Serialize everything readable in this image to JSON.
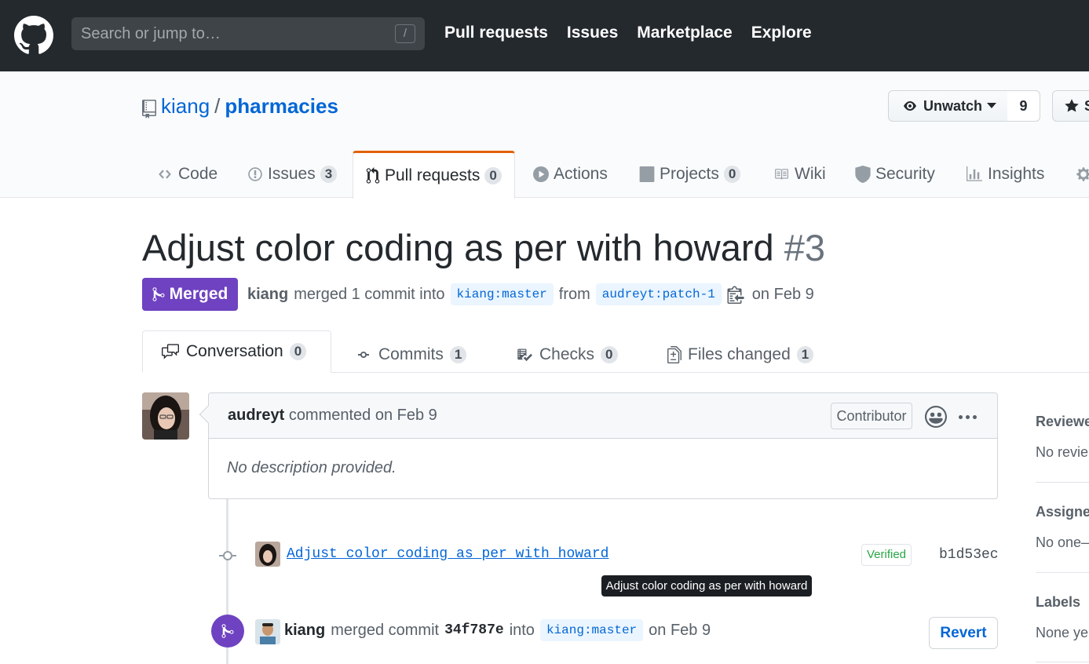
{
  "header": {
    "search_placeholder": "Search or jump to…",
    "search_shortcut": "/",
    "nav": [
      "Pull requests",
      "Issues",
      "Marketplace",
      "Explore"
    ]
  },
  "repo": {
    "owner": "kiang",
    "separator": "/",
    "name": "pharmacies",
    "watch_label": "Unwatch",
    "watch_count": "9",
    "star_label": "S",
    "tabs": [
      {
        "label": "Code",
        "count": null,
        "icon": "code-icon"
      },
      {
        "label": "Issues",
        "count": "3",
        "icon": "issue-icon"
      },
      {
        "label": "Pull requests",
        "count": "0",
        "icon": "pull-request-icon"
      },
      {
        "label": "Actions",
        "count": null,
        "icon": "play-icon"
      },
      {
        "label": "Projects",
        "count": "0",
        "icon": "project-icon"
      },
      {
        "label": "Wiki",
        "count": null,
        "icon": "book-icon"
      },
      {
        "label": "Security",
        "count": null,
        "icon": "shield-icon"
      },
      {
        "label": "Insights",
        "count": null,
        "icon": "graph-icon"
      }
    ]
  },
  "pr": {
    "title": "Adjust color coding as per with howard",
    "number": "#3",
    "state": "Merged",
    "author": "kiang",
    "merged_text": "merged 1 commit into",
    "base_branch": "kiang:master",
    "from_text": "from",
    "head_branch": "audreyt:patch-1",
    "date_text": "on Feb 9",
    "tabs": [
      {
        "label": "Conversation",
        "count": "0"
      },
      {
        "label": "Commits",
        "count": "1"
      },
      {
        "label": "Checks",
        "count": "0"
      },
      {
        "label": "Files changed",
        "count": "1"
      }
    ]
  },
  "comment": {
    "author": "audreyt",
    "action": "commented on Feb 9",
    "badge": "Contributor",
    "body": "No description provided."
  },
  "commit": {
    "message": "Adjust color coding as per with howard",
    "verified": "Verified",
    "sha": "b1d53ec",
    "tooltip": "Adjust color coding as per with howard"
  },
  "merge_event": {
    "author": "kiang",
    "text1": "merged commit",
    "sha": "34f787e",
    "text2": "into",
    "branch": "kiang:master",
    "date": "on Feb 9",
    "revert_label": "Revert"
  },
  "sidebar": {
    "reviewers_title": "Reviewe",
    "reviewers_value": "No revie",
    "assignees_title": "Assigne",
    "assignees_value": "No one–",
    "labels_title": "Labels",
    "labels_value": "None ye"
  },
  "colors": {
    "header_bg": "#24292e",
    "merged_purple": "#6f42c1",
    "link_blue": "#0366d6",
    "active_tab_orange": "#e36209",
    "verified_green": "#28a745"
  }
}
